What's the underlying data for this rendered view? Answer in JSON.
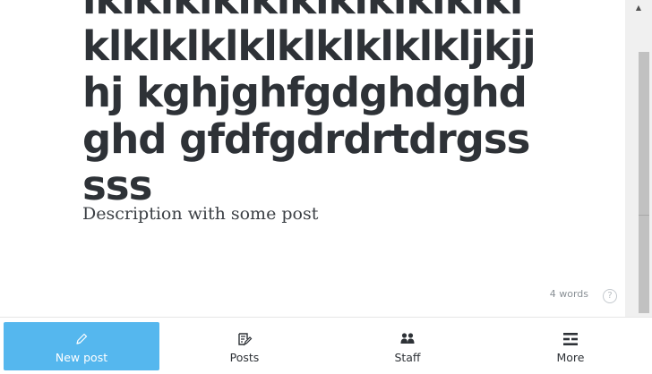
{
  "editor": {
    "title": "lklklklklklklklklklklkl klklklklklklklklklkljkjjhj kghjghfgdghdghdghd gfdfgdrdrtdrgsssss",
    "description": "Description with some post",
    "word_count": "4 words",
    "help_glyph": "?"
  },
  "bottom_nav": {
    "items": [
      {
        "label": "New post",
        "icon": "pencil-icon",
        "active": true
      },
      {
        "label": "Posts",
        "icon": "posts-icon",
        "active": false
      },
      {
        "label": "Staff",
        "icon": "staff-icon",
        "active": false
      },
      {
        "label": "More",
        "icon": "more-icon",
        "active": false
      }
    ]
  },
  "colors": {
    "accent": "#55b7ee",
    "title_text": "#2e3237",
    "muted_text": "#8a9096"
  }
}
